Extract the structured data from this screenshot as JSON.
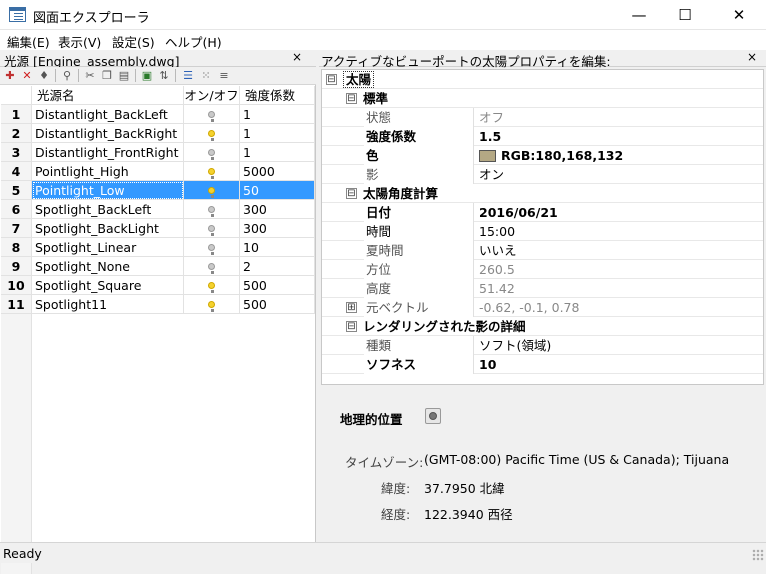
{
  "window": {
    "title": "図面エクスプローラ",
    "minimize_glyph": "—",
    "maximize_glyph": "☐",
    "close_glyph": "✕"
  },
  "menu": [
    "編集(E)",
    "表示(V)",
    "設定(S)",
    "ヘルプ(H)"
  ],
  "lights_panel": {
    "title": "光源 [Engine_assembly.dwg]",
    "close_glyph": "×",
    "columns": [
      "光源名",
      "オン/オフ",
      "強度係数"
    ],
    "rows": [
      {
        "num": "1",
        "name": "Distantlight_BackLeft",
        "on": false,
        "intensity": "1"
      },
      {
        "num": "2",
        "name": "Distantlight_BackRight",
        "on": true,
        "intensity": "1"
      },
      {
        "num": "3",
        "name": "Distantlight_FrontRight",
        "on": false,
        "intensity": "1"
      },
      {
        "num": "4",
        "name": "Pointlight_High",
        "on": true,
        "intensity": "5000"
      },
      {
        "num": "5",
        "name": "Pointlight_Low",
        "on": true,
        "intensity": "50",
        "selected": true
      },
      {
        "num": "6",
        "name": "Spotlight_BackLeft",
        "on": false,
        "intensity": "300"
      },
      {
        "num": "7",
        "name": "Spotlight_BackLight",
        "on": false,
        "intensity": "300"
      },
      {
        "num": "8",
        "name": "Spotlight_Linear",
        "on": false,
        "intensity": "10"
      },
      {
        "num": "9",
        "name": "Spotlight_None",
        "on": false,
        "intensity": "2"
      },
      {
        "num": "10",
        "name": "Spotlight_Square",
        "on": true,
        "intensity": "500"
      },
      {
        "num": "11",
        "name": "Spotlight11",
        "on": true,
        "intensity": "500"
      }
    ]
  },
  "sun_panel": {
    "title": "アクティブなビューポートの太陽プロパティを編集:",
    "close_glyph": "×",
    "root_label": "太陽",
    "collapse_glyph": "⊟",
    "expand_glyph": "⊞",
    "sections": {
      "standard": {
        "label": "標準",
        "status_key": "状態",
        "status_val": "オフ",
        "intensity_key": "強度係数",
        "intensity_val": "1.5",
        "color_key": "色",
        "color_val": "RGB:180,168,132",
        "color_hex": "#b4a884",
        "shadow_key": "影",
        "shadow_val": "オン"
      },
      "angle": {
        "label": "太陽角度計算",
        "date_key": "日付",
        "date_val": "2016/06/21",
        "time_key": "時間",
        "time_val": "15:00",
        "dst_key": "夏時間",
        "dst_val": "いいえ",
        "azimuth_key": "方位",
        "azimuth_val": "260.5",
        "altitude_key": "高度",
        "altitude_val": "51.42",
        "vector_key": "元ベクトル",
        "vector_val": "-0.62, -0.1, 0.78"
      },
      "shadow": {
        "label": "レンダリングされた影の詳細",
        "type_key": "種類",
        "type_val": "ソフト(領域)",
        "soft_key": "ソフネス",
        "soft_val": "10"
      }
    },
    "geo": {
      "heading": "地理的位置",
      "tz_label": "タイムゾーン:",
      "tz_value": "(GMT-08:00) Pacific Time (US & Canada); Tijuana",
      "lat_label": "緯度:",
      "lat_value": "37.7950 北緯",
      "lon_label": "経度:",
      "lon_value": "122.3940 西径"
    }
  },
  "status": {
    "text": "Ready"
  }
}
